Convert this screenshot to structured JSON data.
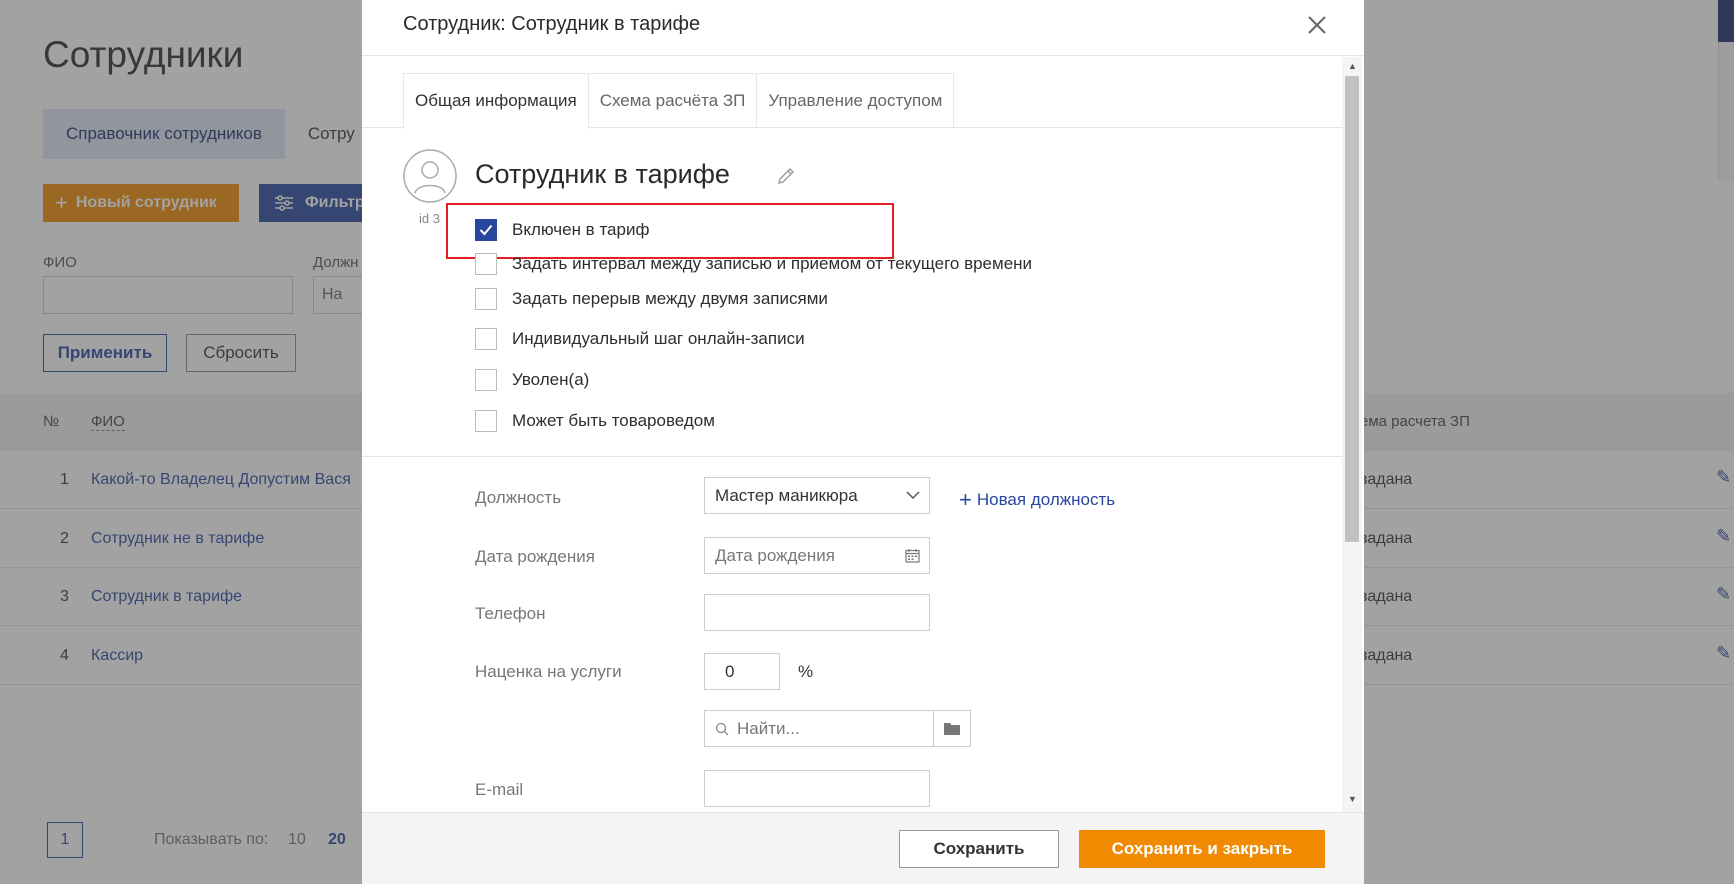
{
  "background": {
    "page_title": "Сотрудники",
    "tabs": [
      {
        "label": "Справочник сотрудников"
      },
      {
        "label": "Сотру"
      }
    ],
    "new_employee_button": "Новый сотрудник",
    "filter_button": "Фильтр",
    "filter_fio_label": "ФИО",
    "filter_position_label": "Должн",
    "filter_position_placeholder": "На",
    "apply_button": "Применить",
    "reset_button": "Сбросить",
    "table": {
      "columns": {
        "num": "№",
        "fio": "ФИО",
        "scheme": "ема расчета ЗП"
      },
      "rows": [
        {
          "num": "1",
          "fio": "Какой-то Владелец Допустим Вася",
          "scheme": "задана"
        },
        {
          "num": "2",
          "fio": "Сотрудник не в тарифе",
          "scheme": "задана"
        },
        {
          "num": "3",
          "fio": "Сотрудник в тарифе",
          "scheme": "задана"
        },
        {
          "num": "4",
          "fio": "Кассир",
          "scheme": "задана"
        }
      ]
    },
    "pager": {
      "current_page": "1",
      "show_label": "Показывать по:",
      "option_10": "10",
      "option_20": "20"
    }
  },
  "modal": {
    "title": "Сотрудник: Сотрудник в тарифе",
    "tabs": [
      {
        "label": "Общая информация",
        "active": true
      },
      {
        "label": "Схема расчёта ЗП",
        "active": false
      },
      {
        "label": "Управление доступом",
        "active": false
      }
    ],
    "employee_name": "Сотрудник в тарифе",
    "employee_id": "id 3",
    "checkboxes": [
      {
        "label": "Включен в тариф",
        "checked": true
      },
      {
        "label": "Задать интервал между записью и приемом от текущего времени",
        "checked": false
      },
      {
        "label": "Задать перерыв между двумя записями",
        "checked": false
      },
      {
        "label": "Индивидуальный шаг онлайн-записи",
        "checked": false
      },
      {
        "label": "Уволен(а)",
        "checked": false
      },
      {
        "label": "Может быть товароведом",
        "checked": false
      }
    ],
    "fields": {
      "position_label": "Должность",
      "position_value": "Мастер маникюра",
      "new_position_link": "Новая должность",
      "birthdate_label": "Дата рождения",
      "birthdate_placeholder": "Дата рождения",
      "phone_label": "Телефон",
      "phone_value": "",
      "markup_label": "Наценка на услуги",
      "markup_value": "0",
      "markup_unit": "%",
      "search_placeholder": "Найти...",
      "email_label": "E-mail",
      "email_value": ""
    },
    "footer": {
      "save_button": "Сохранить",
      "save_close_button": "Сохранить и закрыть"
    }
  },
  "colors": {
    "accent_blue": "#27469e",
    "accent_orange": "#f08a00",
    "highlight_red": "#e31e24"
  }
}
